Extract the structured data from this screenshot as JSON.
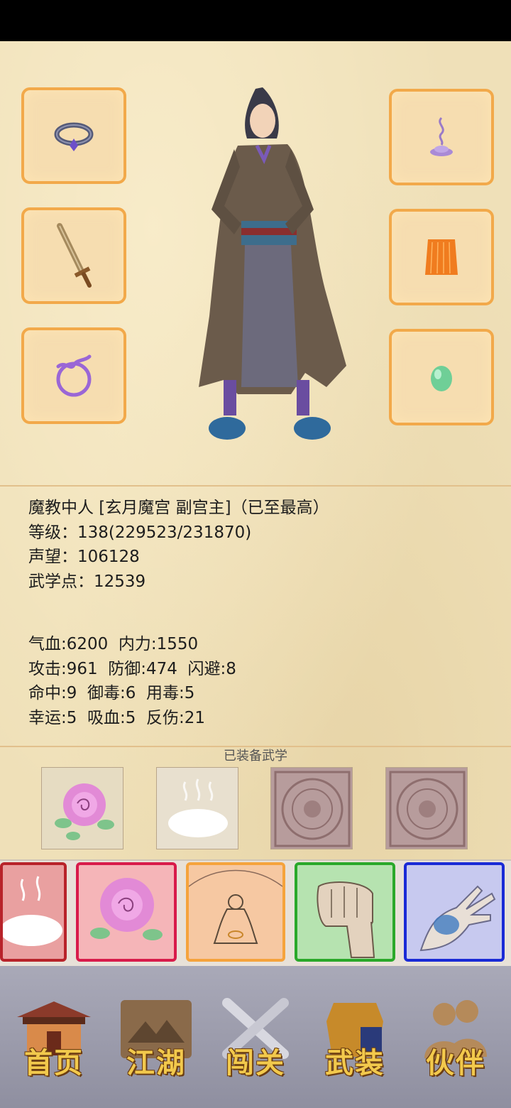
{
  "character": {
    "title": "魔教中人 [玄月魔宫 副宫主]（已至最高）",
    "level": "等级：138(229523/231870)",
    "reputation": "声望：106128",
    "martial_points": "武学点：12539"
  },
  "stats": {
    "line1": "气血:6200  内力:1550",
    "line2": "攻击:961  防御:474  闪避:8",
    "line3": "命中:9  御毒:6  用毒:5",
    "line4": "幸运:5  吸血:5  反伤:21"
  },
  "equipment_slots": {
    "left": [
      "ring-icon",
      "sword-icon",
      "cord-icon"
    ],
    "right": [
      "incense-icon",
      "robe-icon",
      "jade-icon"
    ]
  },
  "equipped_martial_title": "已装备武学",
  "equipped_martial_arts": [
    "rose-art",
    "cloud-art",
    "locked-slot",
    "locked-slot"
  ],
  "skill_cards": [
    "cloud-skill",
    "rose-skill",
    "meditation-skill",
    "fist-skill",
    "palm-skill"
  ],
  "nav": {
    "home": "首页",
    "jianghu": "江湖",
    "challenge": "闯关",
    "gear": "武装",
    "partner": "伙伴"
  },
  "colors": {
    "slot_border": "#f2a94a",
    "parchment": "#efe0b8",
    "nav_text": "#f2c94c"
  }
}
